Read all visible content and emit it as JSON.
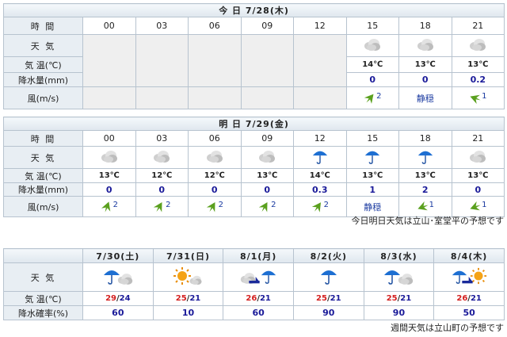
{
  "today": {
    "title": "今 日 7/28(木)",
    "labels": {
      "time": "時 間",
      "weather": "天 気",
      "temp": "気 温(℃)",
      "rain": "降水量(mm)",
      "wind": "風(m/s)"
    },
    "hours": [
      "00",
      "03",
      "06",
      "09",
      "12",
      "15",
      "18",
      "21"
    ],
    "temps": [
      "14℃",
      "13℃",
      "13℃"
    ],
    "rain": [
      "0",
      "0",
      "0.2"
    ],
    "wind_speeds": [
      "2",
      "1"
    ],
    "calm": "静穏"
  },
  "tomorrow": {
    "title": "明 日 7/29(金)",
    "hours": [
      "00",
      "03",
      "06",
      "09",
      "12",
      "15",
      "18",
      "21"
    ],
    "temps": [
      "13℃",
      "12℃",
      "12℃",
      "13℃",
      "14℃",
      "13℃",
      "13℃",
      "13℃"
    ],
    "rain": [
      "0",
      "0",
      "0",
      "0",
      "0.3",
      "1",
      "2",
      "0"
    ],
    "wind": [
      "2",
      "2",
      "2",
      "2",
      "2",
      "",
      "1",
      "1"
    ],
    "calm": "静穏"
  },
  "note1": "今日明日天気は立山･室堂平の予想です",
  "weekly": {
    "labels": {
      "weather": "天 気",
      "temp": "気 温(℃)",
      "pop": "降水確率(%)"
    },
    "days": [
      "7/30(土)",
      "7/31(日)",
      "8/1(月)",
      "8/2(火)",
      "8/3(水)",
      "8/4(木)"
    ],
    "hi": [
      "29",
      "25",
      "26",
      "25",
      "25",
      "26"
    ],
    "lo": [
      "24",
      "21",
      "21",
      "21",
      "21",
      "21"
    ],
    "slash": "/",
    "pop": [
      "60",
      "10",
      "60",
      "90",
      "90",
      "50"
    ]
  },
  "note2": "週間天気は立山町の予想です",
  "colors": {
    "header_bg": "#e8eef3",
    "border": "#b7c3cf",
    "high": "#d4201f",
    "low": "#1a1a99"
  }
}
